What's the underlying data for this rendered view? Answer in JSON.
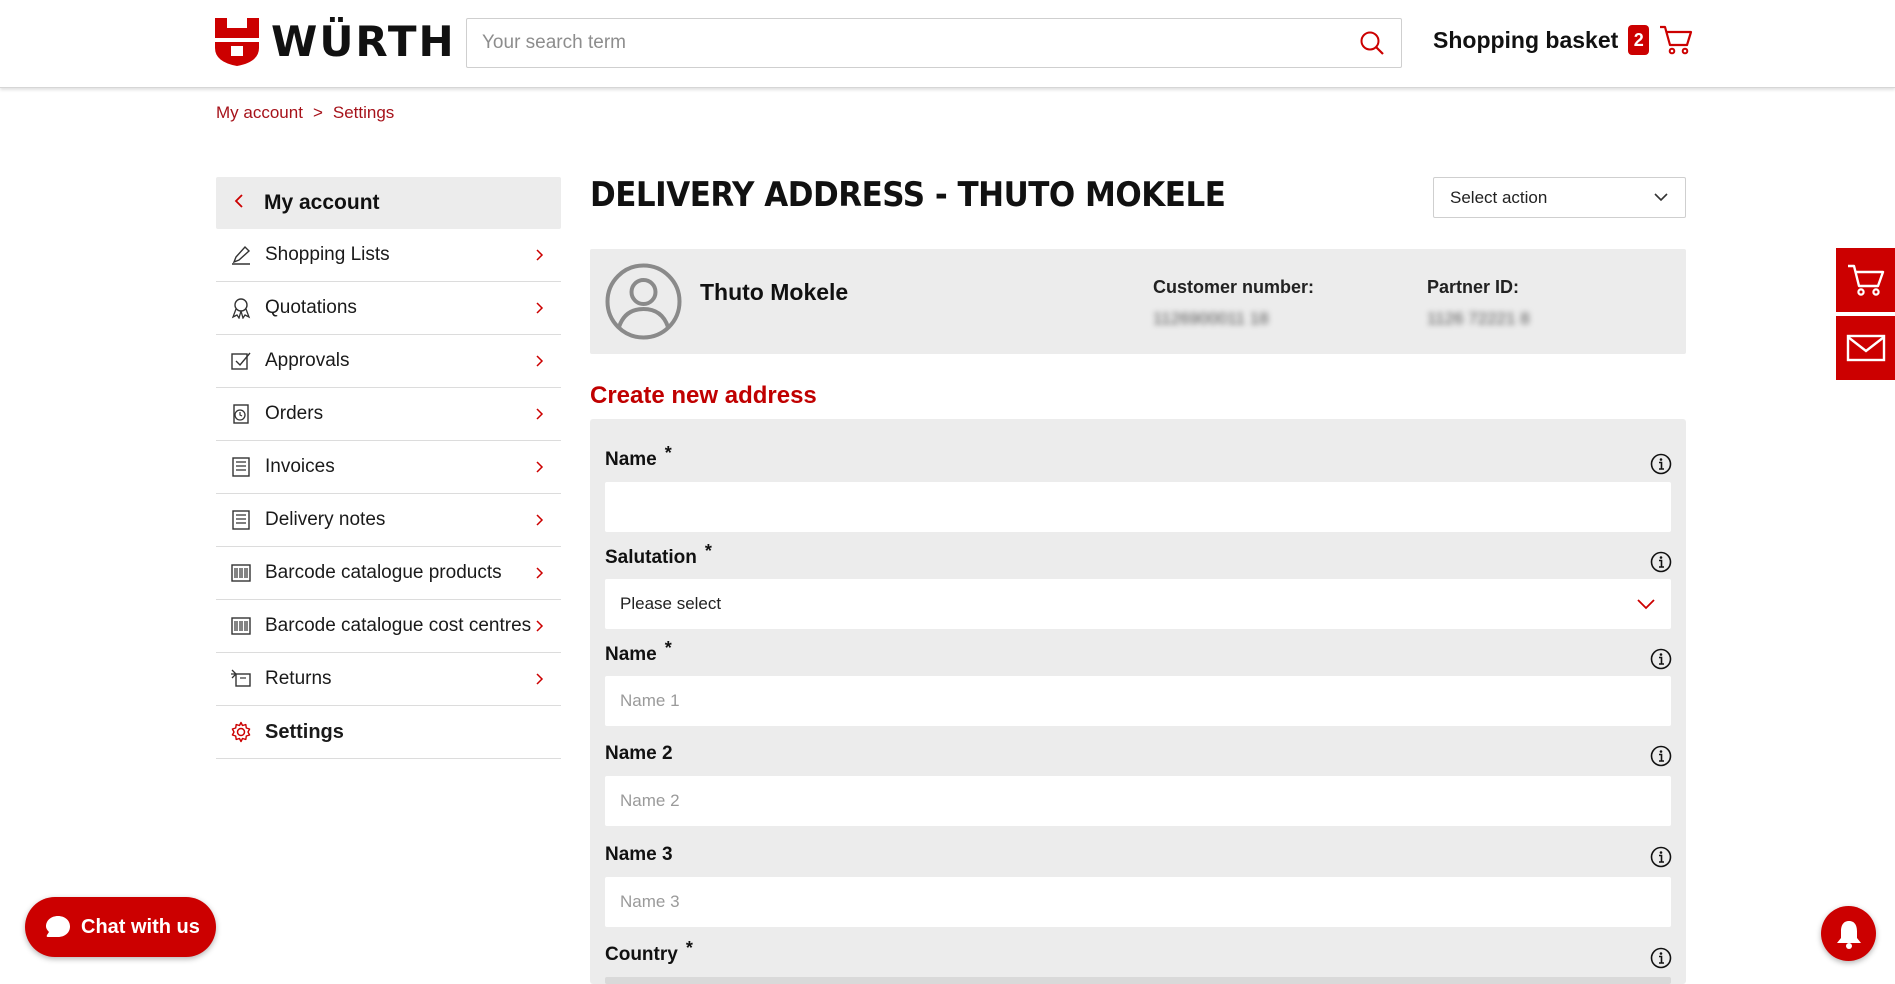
{
  "brand": {
    "name": "WÜRTH",
    "accent": "#cc0000"
  },
  "search": {
    "placeholder": "Your search term"
  },
  "basket": {
    "label": "Shopping basket",
    "count": "2"
  },
  "breadcrumb": {
    "items": [
      "My account",
      ">",
      "Settings"
    ]
  },
  "sidebar": {
    "header": "My account",
    "items": [
      {
        "label": "Shopping Lists",
        "icon": "pencil-icon"
      },
      {
        "label": "Quotations",
        "icon": "ribbon-icon"
      },
      {
        "label": "Approvals",
        "icon": "checkbox-icon"
      },
      {
        "label": "Orders",
        "icon": "orders-icon"
      },
      {
        "label": "Invoices",
        "icon": "document-icon"
      },
      {
        "label": "Delivery notes",
        "icon": "document-icon"
      },
      {
        "label": "Barcode catalogue products",
        "icon": "barcode-icon"
      },
      {
        "label": "Barcode catalogue cost centres",
        "icon": "barcode-icon"
      },
      {
        "label": "Returns",
        "icon": "returns-icon"
      },
      {
        "label": "Settings",
        "icon": "gear-icon",
        "active": true
      }
    ]
  },
  "main": {
    "title": "DELIVERY ADDRESS - THUTO MOKELE",
    "select_action": "Select action",
    "customer": {
      "name": "Thuto Mokele",
      "customer_number_label": "Customer number:",
      "customer_number_value": "1126900011 18",
      "partner_id_label": "Partner ID:",
      "partner_id_value": "1126 72221 8"
    },
    "section_title": "Create new address",
    "fields": [
      {
        "label": "Name",
        "required": "*",
        "value": "",
        "placeholder": ""
      },
      {
        "label": "Salutation",
        "required": "*",
        "value": "Please select",
        "type": "select"
      },
      {
        "label": "Name",
        "required": "*",
        "value": "",
        "placeholder": "Name 1"
      },
      {
        "label": "Name 2",
        "required": "",
        "value": "",
        "placeholder": "Name 2"
      },
      {
        "label": "Name 3",
        "required": "",
        "value": "",
        "placeholder": "Name 3"
      },
      {
        "label": "Country",
        "required": "*",
        "value": ""
      }
    ]
  },
  "chat": {
    "label": "Chat with us"
  }
}
